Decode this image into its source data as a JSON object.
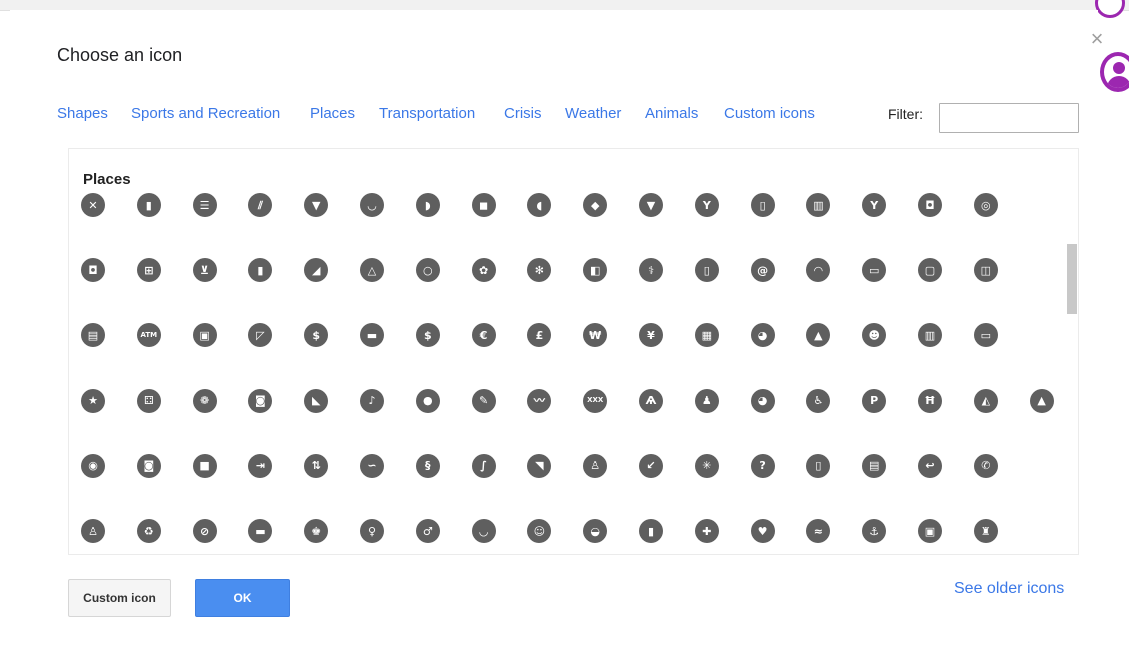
{
  "dialog": {
    "title": "Choose an icon",
    "close_glyph": "×"
  },
  "tabs": [
    {
      "label": "Shapes"
    },
    {
      "label": "Sports and Recreation"
    },
    {
      "label": "Places"
    },
    {
      "label": "Transportation"
    },
    {
      "label": "Crisis"
    },
    {
      "label": "Weather"
    },
    {
      "label": "Animals"
    },
    {
      "label": "Custom icons"
    }
  ],
  "filter": {
    "label": "Filter:",
    "value": "",
    "placeholder": ""
  },
  "section": {
    "title": "Places"
  },
  "icons": [
    [
      {
        "name": "restaurant-icon",
        "glyph": "✕"
      },
      {
        "name": "fast-food-icon",
        "glyph": "▮"
      },
      {
        "name": "burger-icon",
        "glyph": "☰"
      },
      {
        "name": "bread-icon",
        "glyph": "⫽"
      },
      {
        "name": "pizza-icon",
        "glyph": "▼"
      },
      {
        "name": "soup-icon",
        "glyph": "◡"
      },
      {
        "name": "cheese-icon",
        "glyph": "◗"
      },
      {
        "name": "steak-icon",
        "glyph": "◼"
      },
      {
        "name": "chicken-icon",
        "glyph": "◖"
      },
      {
        "name": "fish-icon",
        "glyph": "◆"
      },
      {
        "name": "ice-cream-icon",
        "glyph": "▼"
      },
      {
        "name": "cocktail-icon",
        "glyph": "Y"
      },
      {
        "name": "cup-icon",
        "glyph": "▯"
      },
      {
        "name": "beer-icon",
        "glyph": "▥"
      },
      {
        "name": "wine-icon",
        "glyph": "Y"
      },
      {
        "name": "coffee-icon",
        "glyph": "◘"
      },
      {
        "name": "bagel-icon",
        "glyph": "◎"
      }
    ],
    [
      {
        "name": "shopping-bag-icon",
        "glyph": "◘"
      },
      {
        "name": "gift-icon",
        "glyph": "⊞"
      },
      {
        "name": "cart-icon",
        "glyph": "⊻"
      },
      {
        "name": "drinks-icon",
        "glyph": "▮"
      },
      {
        "name": "shoe-icon",
        "glyph": "◢"
      },
      {
        "name": "hanger-icon",
        "glyph": "△"
      },
      {
        "name": "ring-icon",
        "glyph": "○"
      },
      {
        "name": "flower-icon",
        "glyph": "✿"
      },
      {
        "name": "grain-icon",
        "glyph": "✻"
      },
      {
        "name": "store-icon",
        "glyph": "◧"
      },
      {
        "name": "pharmacy-icon",
        "glyph": "⚕"
      },
      {
        "name": "phone-icon",
        "glyph": "▯"
      },
      {
        "name": "email-icon",
        "glyph": "@"
      },
      {
        "name": "wifi-icon",
        "glyph": "◠"
      },
      {
        "name": "laptop-icon",
        "glyph": "▭"
      },
      {
        "name": "monitor-icon",
        "glyph": "▢"
      },
      {
        "name": "book-icon",
        "glyph": "◫"
      }
    ],
    [
      {
        "name": "newspaper-icon",
        "glyph": "▤"
      },
      {
        "name": "atm-icon",
        "glyph": "ATM"
      },
      {
        "name": "cash-icon",
        "glyph": "▣"
      },
      {
        "name": "chart-up-icon",
        "glyph": "◸"
      },
      {
        "name": "dollar-exchange-icon",
        "glyph": "$"
      },
      {
        "name": "bill-icon",
        "glyph": "▬"
      },
      {
        "name": "dollar-icon",
        "glyph": "$"
      },
      {
        "name": "euro-icon",
        "glyph": "€"
      },
      {
        "name": "pound-icon",
        "glyph": "£"
      },
      {
        "name": "won-icon",
        "glyph": "₩"
      },
      {
        "name": "yen-icon",
        "glyph": "¥"
      },
      {
        "name": "calendar-icon",
        "glyph": "▦"
      },
      {
        "name": "speech-bubble-icon",
        "glyph": "◕"
      },
      {
        "name": "birthday-cake-icon",
        "glyph": "▲"
      },
      {
        "name": "family-icon",
        "glyph": "☻"
      },
      {
        "name": "film-icon",
        "glyph": "▥"
      },
      {
        "name": "ticket-icon",
        "glyph": "▭"
      }
    ],
    [
      {
        "name": "star-ticket-icon",
        "glyph": "★"
      },
      {
        "name": "dice-icon",
        "glyph": "⚃"
      },
      {
        "name": "flower-emblem-icon",
        "glyph": "❁"
      },
      {
        "name": "elephant-icon",
        "glyph": "◙"
      },
      {
        "name": "piano-icon",
        "glyph": "◣"
      },
      {
        "name": "music-note-icon",
        "glyph": "♪"
      },
      {
        "name": "bowling-icon",
        "glyph": "●"
      },
      {
        "name": "microphone-icon",
        "glyph": "✎"
      },
      {
        "name": "mustache-icon",
        "glyph": "〰"
      },
      {
        "name": "xxx-icon",
        "glyph": "XXX"
      },
      {
        "name": "eiffel-tower-icon",
        "glyph": "Ѧ"
      },
      {
        "name": "statue-icon",
        "glyph": "♟"
      },
      {
        "name": "palette-icon",
        "glyph": "◕"
      },
      {
        "name": "wheelchair-icon",
        "glyph": "♿"
      },
      {
        "name": "parking-icon",
        "glyph": "P"
      },
      {
        "name": "picnic-table-icon",
        "glyph": "Ħ"
      },
      {
        "name": "tent-icon",
        "glyph": "◭"
      },
      {
        "name": "tree-icon",
        "glyph": "▲"
      }
    ],
    [
      {
        "name": "binoculars-icon",
        "glyph": "◉"
      },
      {
        "name": "camera-icon",
        "glyph": "◙"
      },
      {
        "name": "video-camera-icon",
        "glyph": "■"
      },
      {
        "name": "login-icon",
        "glyph": "⇥"
      },
      {
        "name": "elevator-icon",
        "glyph": "⇅"
      },
      {
        "name": "hose-icon",
        "glyph": "∽"
      },
      {
        "name": "swirl-icon",
        "glyph": "§"
      },
      {
        "name": "ramp-icon",
        "glyph": "∫"
      },
      {
        "name": "stairs-icon",
        "glyph": "◥"
      },
      {
        "name": "hiker-icon",
        "glyph": "♙"
      },
      {
        "name": "arrow-down-left-icon",
        "glyph": "↙"
      },
      {
        "name": "snowflake-icon",
        "glyph": "✳"
      },
      {
        "name": "info-person-icon",
        "glyph": "?"
      },
      {
        "name": "tablet-icon",
        "glyph": "▯"
      },
      {
        "name": "printer-icon",
        "glyph": "▤"
      },
      {
        "name": "telephone-curve-icon",
        "glyph": "↩"
      },
      {
        "name": "telephone-icon",
        "glyph": "✆"
      }
    ],
    [
      {
        "name": "trash-person-icon",
        "glyph": "♙"
      },
      {
        "name": "recycle-icon",
        "glyph": "♻"
      },
      {
        "name": "no-smoking-icon",
        "glyph": "⊘"
      },
      {
        "name": "smoking-icon",
        "glyph": "▬"
      },
      {
        "name": "restroom-icon",
        "glyph": "♚"
      },
      {
        "name": "woman-icon",
        "glyph": "♀"
      },
      {
        "name": "man-icon",
        "glyph": "♂"
      },
      {
        "name": "bathtub-icon",
        "glyph": "◡"
      },
      {
        "name": "baby-icon",
        "glyph": "☺"
      },
      {
        "name": "stroller-icon",
        "glyph": "◒"
      },
      {
        "name": "fire-extinguisher-icon",
        "glyph": "▮"
      },
      {
        "name": "first-aid-icon",
        "glyph": "✚"
      },
      {
        "name": "broken-heart-icon",
        "glyph": "♥"
      },
      {
        "name": "waves-icon",
        "glyph": "≈"
      },
      {
        "name": "anchor-icon",
        "glyph": "⚓"
      },
      {
        "name": "train-icon",
        "glyph": "▣"
      },
      {
        "name": "monument-icon",
        "glyph": "♜"
      }
    ]
  ],
  "buttons": {
    "custom_icon": "Custom icon",
    "ok": "OK"
  },
  "links": {
    "see_older": "See older icons"
  },
  "colors": {
    "link": "#3b78e7",
    "icon_fill": "#5f5f5f",
    "ok_button": "#4a8ef0",
    "avatar_accent": "#9c27b0"
  }
}
